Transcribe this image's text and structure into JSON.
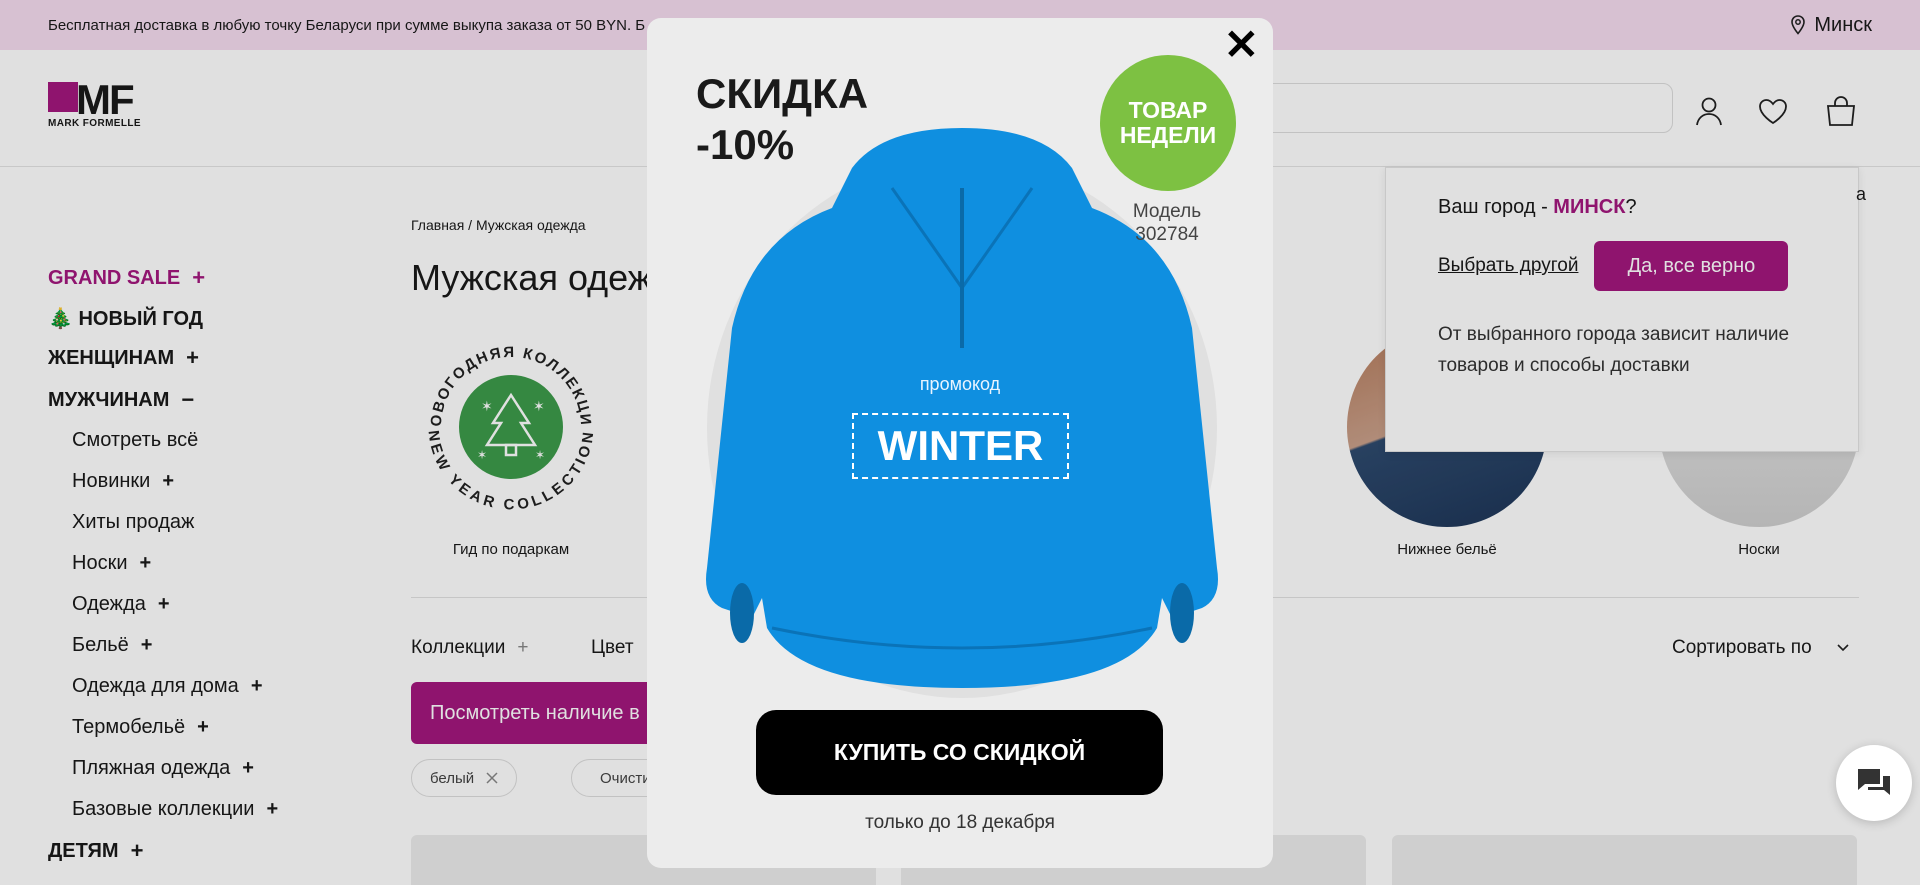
{
  "topbar": {
    "promo": "Бесплатная доставка в любую точку Беларуси при сумме выкупа заказа от 50 BYN. Б",
    "city": "Минск"
  },
  "logo": {
    "text": "MF",
    "subtitle": "MARK FORMELLE"
  },
  "icons": {
    "location": "pin-icon",
    "account": "user-icon",
    "favorites": "heart-icon",
    "cart": "bag-icon",
    "close": "close-icon",
    "chat": "chat-icon"
  },
  "sidebar": {
    "items": [
      {
        "label": "GRAND SALE",
        "sign": "+",
        "type": "top",
        "color": "#a3177e"
      },
      {
        "label": "🎄 НОВЫЙ ГОД",
        "sign": "",
        "type": "top"
      },
      {
        "label": "ЖЕНЩИНАМ",
        "sign": "+",
        "type": "top"
      },
      {
        "label": "МУЖЧИНАМ",
        "sign": "−",
        "type": "top"
      },
      {
        "label": "Смотреть всё",
        "sign": "",
        "type": "sub"
      },
      {
        "label": "Новинки",
        "sign": "+",
        "type": "sub"
      },
      {
        "label": "Хиты продаж",
        "sign": "",
        "type": "sub"
      },
      {
        "label": "Носки",
        "sign": "+",
        "type": "sub"
      },
      {
        "label": "Одежда",
        "sign": "+",
        "type": "sub"
      },
      {
        "label": "Бельё",
        "sign": "+",
        "type": "sub"
      },
      {
        "label": "Одежда для дома",
        "sign": "+",
        "type": "sub"
      },
      {
        "label": "Термобельё",
        "sign": "+",
        "type": "sub"
      },
      {
        "label": "Пляжная одежда",
        "sign": "+",
        "type": "sub"
      },
      {
        "label": "Базовые коллекции",
        "sign": "+",
        "type": "sub"
      },
      {
        "label": "ДЕТЯМ",
        "sign": "+",
        "type": "top"
      }
    ]
  },
  "main": {
    "breadcrumb": "Главная / Мужская одежда",
    "title": "Мужская одеж",
    "categories": [
      {
        "label": "Гид по подаркам"
      },
      {
        "label": "Нижнее бельё"
      },
      {
        "label": "Носки"
      }
    ],
    "gift_badge_top": "НОВОГОДНЯЯ КОЛЛЕКЦИЯ",
    "gift_badge_bottom": "NEW YEAR COLLECTION",
    "filters": {
      "collections": "Коллекции",
      "collections_sign": "+",
      "color": "Цвет",
      "sort": "Сортировать по"
    },
    "availability_button": "Посмотреть наличие в",
    "chips": {
      "white": "белый",
      "clear": "Очисти"
    }
  },
  "city_popup": {
    "question_prefix": "Ваш город - ",
    "city": "МИНСК",
    "question_suffix": "?",
    "choose_other": "Выбрать другой",
    "confirm": "Да, все верно",
    "note": "От выбранного города зависит наличие товаров и способы доставки",
    "corner_letter": "а"
  },
  "modal": {
    "headline_line1": "СКИДКА",
    "headline_line2": "-10%",
    "badge_line1": "ТОВАР",
    "badge_line2": "НЕДЕЛИ",
    "model_label": "Модель",
    "model_number": "302784",
    "promo_label": "промокод",
    "promo_code": "WINTER",
    "buy_button": "КУПИТЬ СО СКИДКОЙ",
    "until": "только до 18 декабря"
  },
  "colors": {
    "accent": "#a3177e",
    "topbar": "#f5dcf0",
    "badge": "#7dc142",
    "hoodie": "#0f8fe0"
  }
}
